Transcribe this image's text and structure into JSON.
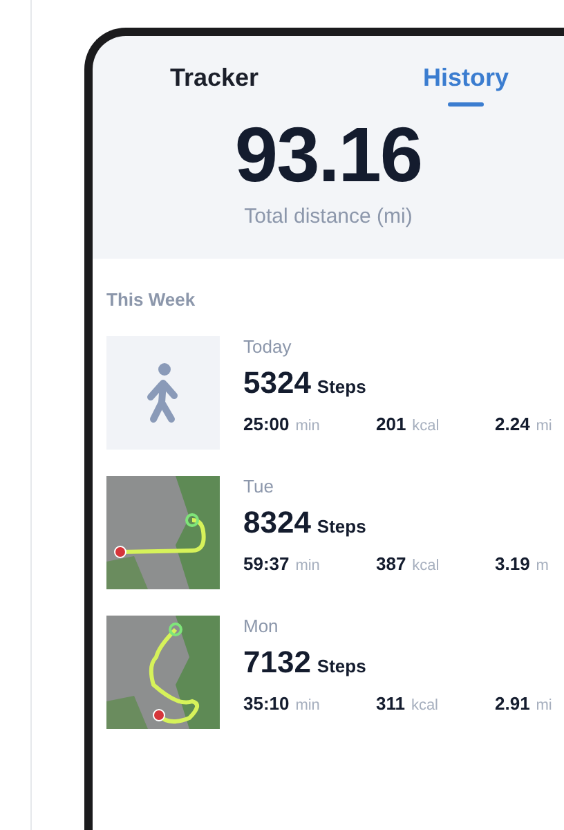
{
  "tabs": [
    {
      "label": "Tracker",
      "selected": false
    },
    {
      "label": "History",
      "selected": true
    }
  ],
  "summary": {
    "value": "93.16",
    "label": "Total distance (mi)"
  },
  "section_title": "This Week",
  "activities": [
    {
      "kind": "walk",
      "day": "Today",
      "steps": "5324",
      "steps_unit": "Steps",
      "time": "25:00",
      "time_unit": "min",
      "energy": "201",
      "energy_unit": "kcal",
      "distance": "2.24",
      "distance_unit": "mi"
    },
    {
      "kind": "map",
      "day": "Tue",
      "steps": "8324",
      "steps_unit": "Steps",
      "time": "59:37",
      "time_unit": "min",
      "energy": "387",
      "energy_unit": "kcal",
      "distance": "3.19",
      "distance_unit": "m"
    },
    {
      "kind": "map",
      "day": "Mon",
      "steps": "7132",
      "steps_unit": "Steps",
      "time": "35:10",
      "time_unit": "min",
      "energy": "311",
      "energy_unit": "kcal",
      "distance": "2.91",
      "distance_unit": "mi"
    }
  ]
}
